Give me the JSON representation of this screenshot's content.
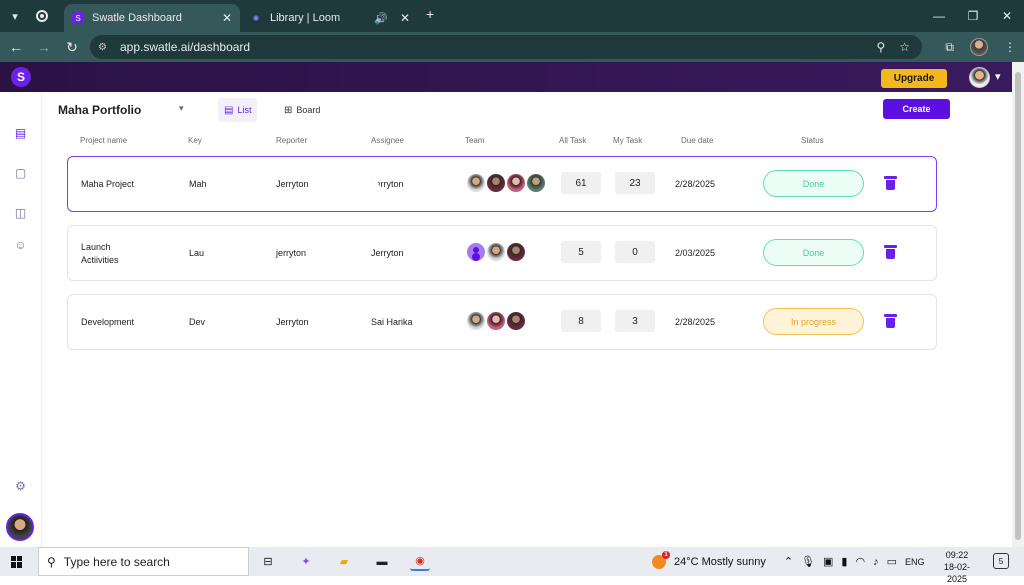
{
  "browser": {
    "tabs": [
      {
        "title": "Swatle Dashboard",
        "active": true
      },
      {
        "title": "Library | Loom",
        "active": false
      }
    ],
    "url": "app.swatle.ai/dashboard"
  },
  "header": {
    "upgrade_label": "Upgrade"
  },
  "toolbar": {
    "portfolio_name": "Maha Portfolio",
    "view_list_label": "List",
    "view_board_label": "Board",
    "create_label": "Create"
  },
  "columns": {
    "project_name": "Project  name",
    "key": "Key",
    "reporter": "Reporter",
    "assignee": "Assignee",
    "team": "Team",
    "all_task": "All Task",
    "my_task": "My Task",
    "due_date": "Due date",
    "status": "Status"
  },
  "projects": [
    {
      "name_line1": "Maha Project",
      "name_line2": "",
      "key": "Mah",
      "reporter": "Jerryton",
      "assignee": "Jerryton",
      "all_task": "61",
      "my_task": "23",
      "due_date": "2/28/2025",
      "status": "Done",
      "team_icons": [
        "avatar-1",
        "avatar-2",
        "avatar-3",
        "avatar-4"
      ]
    },
    {
      "name_line1": "Launch",
      "name_line2": "Actiivities",
      "key": "Lau",
      "reporter": "jerryton",
      "assignee": "Jerryton",
      "all_task": "5",
      "my_task": "0",
      "due_date": "2/03/2025",
      "status": "Done",
      "team_icons": [
        "avatar-user-icon",
        "avatar-1",
        "avatar-2"
      ]
    },
    {
      "name_line1": "Development",
      "name_line2": "",
      "key": "Dev",
      "reporter": "Jerryton",
      "assignee": "Sai Harika",
      "all_task": "8",
      "my_task": "3",
      "due_date": "2/28/2025",
      "status": "In progress",
      "team_icons": [
        "avatar-1",
        "avatar-3",
        "avatar-2"
      ]
    }
  ],
  "taskbar": {
    "search_placeholder": "Type here to search",
    "weather_badge": "1",
    "weather": "24°C  Mostly sunny",
    "language": "ENG",
    "time": "09:22",
    "date": "18-02-2025",
    "notifications": "5"
  },
  "colors": {
    "brand": "#6b21e8",
    "done": "#4cc79b",
    "in_progress": "#e0a52a",
    "upgrade": "#f4b81f"
  }
}
